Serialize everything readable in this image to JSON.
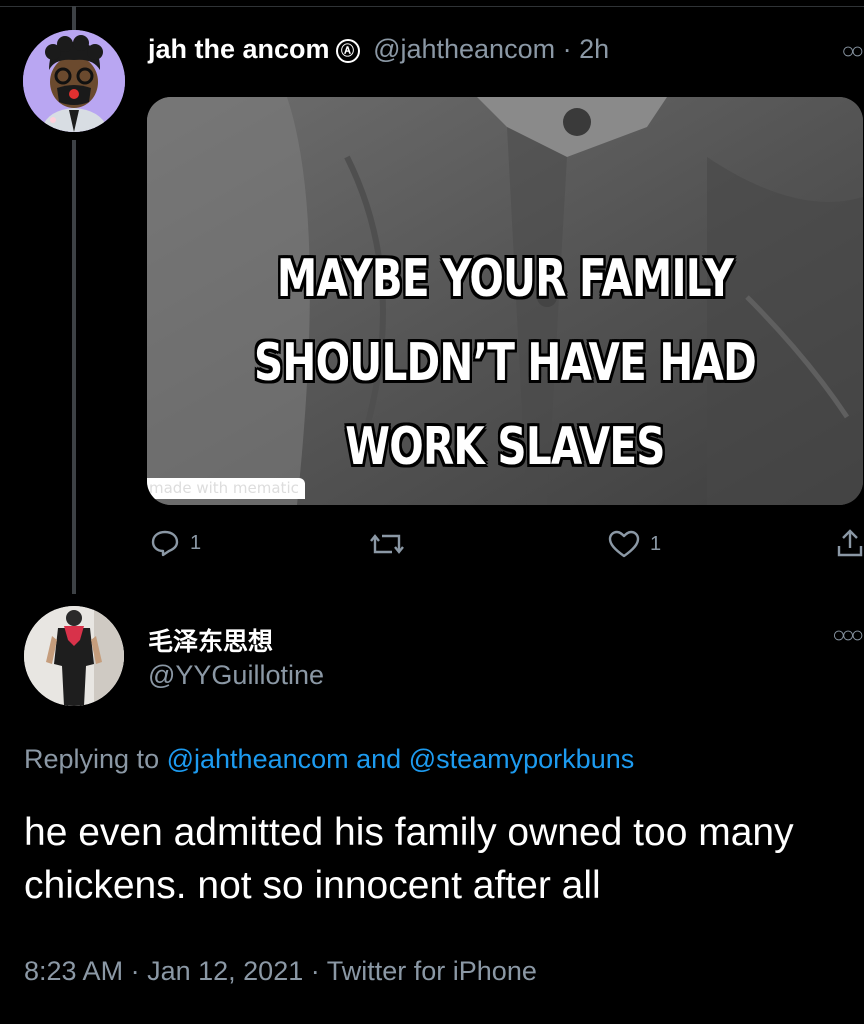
{
  "tweet1": {
    "display_name": "jah the ancom",
    "badge": "Ⓐ",
    "handle": "@jahtheancom",
    "separator": "·",
    "time": "2h",
    "media": {
      "caption_lines": [
        "MAYBE YOUR FAMILY",
        "SHOULDN’T HAVE HAD",
        "WORK SLAVES"
      ],
      "watermark": "made with mematic"
    },
    "actions": {
      "reply_count": "1",
      "retweet_count": "",
      "like_count": "1"
    }
  },
  "tweet2": {
    "display_name": "毛泽东思想",
    "handle": "@YYGuillotine",
    "replying_prefix": "Replying to",
    "replying_user1": "@jahtheancom",
    "replying_and": "and",
    "replying_user2": "@steamyporkbuns",
    "text": "he even admitted his family owned too many chickens. not so innocent after all",
    "time": "8:23 AM",
    "date": "Jan 12, 2021",
    "source": "Twitter for iPhone",
    "sep": "·"
  },
  "colors": {
    "background": "#000000",
    "secondary_text": "#8b98a5",
    "link": "#1d9bf0",
    "avatar1_bg": "#b9a6f2"
  },
  "icons": [
    "reply-icon",
    "retweet-icon",
    "like-icon",
    "share-icon",
    "more-icon",
    "anarchy-badge-icon"
  ]
}
